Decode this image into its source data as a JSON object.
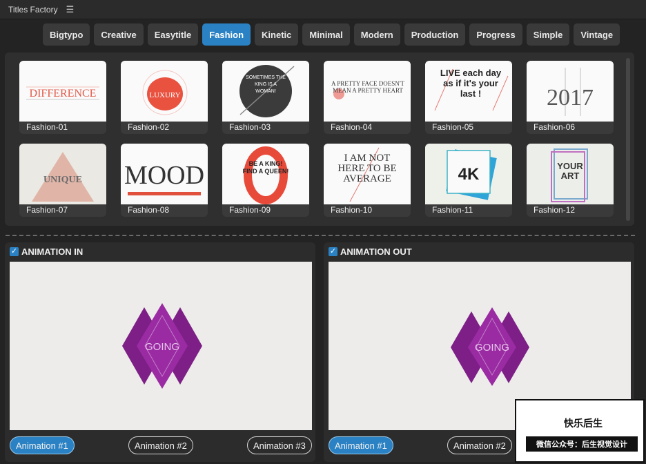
{
  "window": {
    "title": "Titles Factory",
    "menu_icon": "hamburger-menu-icon"
  },
  "tabs": [
    {
      "label": "Bigtypo",
      "active": false
    },
    {
      "label": "Creative",
      "active": false
    },
    {
      "label": "Easytitle",
      "active": false
    },
    {
      "label": "Fashion",
      "active": true
    },
    {
      "label": "Kinetic",
      "active": false
    },
    {
      "label": "Minimal",
      "active": false
    },
    {
      "label": "Modern",
      "active": false
    },
    {
      "label": "Production",
      "active": false
    },
    {
      "label": "Progress",
      "active": false
    },
    {
      "label": "Simple",
      "active": false
    },
    {
      "label": "Vintage",
      "active": false
    }
  ],
  "templates": [
    {
      "label": "Fashion-01",
      "thumb_text": "DIFFERENCE"
    },
    {
      "label": "Fashion-02",
      "thumb_text": "LUXURY"
    },
    {
      "label": "Fashion-03",
      "thumb_text": "SOMETIMES THE KING IS A WOMAN!"
    },
    {
      "label": "Fashion-04",
      "thumb_text": "A PRETTY FACE DOESN'T MEAN A PRETTY HEART"
    },
    {
      "label": "Fashion-05",
      "thumb_text": "LIVE each day as if it's your last !"
    },
    {
      "label": "Fashion-06",
      "thumb_text": "2017"
    },
    {
      "label": "Fashion-07",
      "thumb_text": "UNIQUE"
    },
    {
      "label": "Fashion-08",
      "thumb_text": "MOOD"
    },
    {
      "label": "Fashion-09",
      "thumb_text": "BE A KING! FIND A QUEEN!"
    },
    {
      "label": "Fashion-10",
      "thumb_text": "I AM NOT HERE TO BE AVERAGE"
    },
    {
      "label": "Fashion-11",
      "thumb_text": "4K"
    },
    {
      "label": "Fashion-12",
      "thumb_text": "YOUR ART"
    }
  ],
  "animation_in": {
    "title": "ANIMATION IN",
    "checked": true,
    "preview_text": "GOING",
    "buttons": [
      "Animation #1",
      "Animation #2",
      "Animation #3"
    ],
    "active_index": 0
  },
  "animation_out": {
    "title": "ANIMATION OUT",
    "checked": true,
    "preview_text": "GOING",
    "buttons": [
      "Animation #1",
      "Animation #2"
    ],
    "active_index": 0
  },
  "watermark": {
    "line1": "快乐后生",
    "line2": "微信公众号：后生视觉设计"
  },
  "colors": {
    "accent": "#2a82c4",
    "background": "#232323",
    "panel": "#2f2f2f",
    "diamond": "#7d1f86"
  }
}
